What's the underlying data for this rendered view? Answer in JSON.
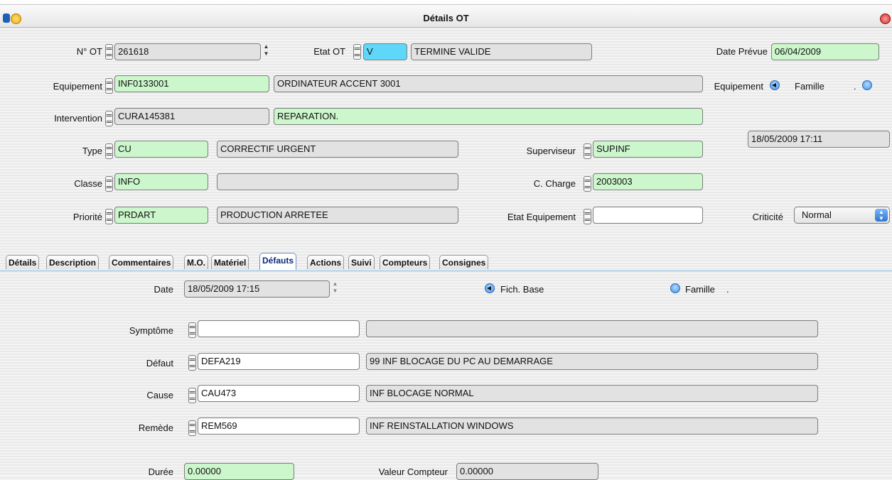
{
  "window": {
    "title": "Détails OT"
  },
  "header": {
    "n_ot": {
      "label": "N° OT",
      "value": "261618"
    },
    "etat_ot": {
      "label": "Etat OT",
      "code": "V",
      "desc": "TERMINE VALIDE"
    },
    "date_prevue": {
      "label": "Date Prévue",
      "value": "06/04/2009"
    },
    "equipement": {
      "label": "Equipement",
      "code": "INF0133001",
      "desc": "ORDINATEUR ACCENT 3001"
    },
    "radio_equipement": {
      "label": "Equipement"
    },
    "radio_famille": {
      "label": "Famille",
      "suffix": "."
    },
    "intervention": {
      "label": "Intervention",
      "code": "CURA145381",
      "desc": "REPARATION."
    },
    "timestamp": "18/05/2009 17:11",
    "type": {
      "label": "Type",
      "code": "CU",
      "desc": "CORRECTIF URGENT"
    },
    "superviseur": {
      "label": "Superviseur",
      "value": "SUPINF"
    },
    "classe": {
      "label": "Classe",
      "code": "INFO",
      "desc": ""
    },
    "c_charge": {
      "label": "C. Charge",
      "value": "2003003"
    },
    "priorite": {
      "label": "Priorité",
      "code": "PRDART",
      "desc": "PRODUCTION ARRETEE"
    },
    "etat_equipement": {
      "label": "Etat Equipement",
      "value": ""
    },
    "criticite": {
      "label": "Criticité",
      "value": "Normal"
    }
  },
  "tabs": [
    "Détails",
    "Description",
    "Commentaires",
    "M.O.",
    "Matériel",
    "Défauts",
    "Actions",
    "Suivi",
    "Compteurs",
    "Consignes"
  ],
  "active_tab": "Défauts",
  "defauts": {
    "date": {
      "label": "Date",
      "value": "18/05/2009 17:15"
    },
    "fich_base": {
      "label": "Fich. Base"
    },
    "famille": {
      "label": "Famille",
      "suffix": "."
    },
    "symptome": {
      "label": "Symptôme",
      "code": "",
      "desc": ""
    },
    "defaut": {
      "label": "Défaut",
      "code": "DEFA219",
      "desc": "99 INF BLOCAGE DU PC AU DEMARRAGE"
    },
    "cause": {
      "label": "Cause",
      "code": "CAU473",
      "desc": "INF BLOCAGE NORMAL"
    },
    "remede": {
      "label": "Remède",
      "code": "REM569",
      "desc": "INF REINSTALLATION WINDOWS"
    },
    "duree": {
      "label": "Durée",
      "value": "0.00000"
    },
    "valeur_compteur": {
      "label": "Valeur Compteur",
      "value": "0.00000"
    }
  },
  "colors": {
    "editable": "#ccf7cc",
    "readonly": "#e2e2e2",
    "focus": "#5fd7f9",
    "active_tab_text": "#0b2a7a"
  }
}
